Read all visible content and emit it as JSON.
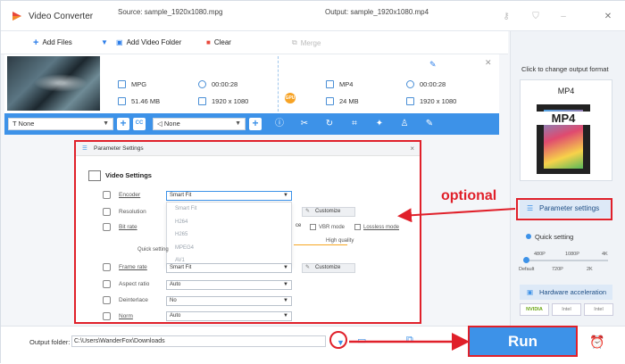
{
  "app": {
    "title": "Video Converter"
  },
  "toolbar": {
    "add_files": "Add Files",
    "add_video_folder": "Add Video Folder",
    "clear": "Clear",
    "merge": "Merge"
  },
  "task": {
    "source": "Source: sample_1920x1080.mpg",
    "output": "Output: sample_1920x1080.mp4",
    "src_format": "MPG",
    "src_duration": "00:00:28",
    "src_size": "51.46 MB",
    "src_resolution": "1920 x 1080",
    "out_format": "MP4",
    "out_duration": "00:00:28",
    "out_size": "24 MB",
    "out_resolution": "1920 x 1080",
    "gpu_badge": "GPU"
  },
  "editbar": {
    "subtitle": "None",
    "audio": "None"
  },
  "right_panel": {
    "click_to_change": "Click to change output format",
    "format": "MP4",
    "format_icon_text": "MP4",
    "parameter_settings": "Parameter settings",
    "quick_setting": "Quick setting",
    "ticks_top": [
      "480P",
      "1080P",
      "4K"
    ],
    "ticks_bottom": [
      "Default",
      "720P",
      "2K"
    ],
    "hardware_acceleration": "Hardware acceleration",
    "chips": [
      "NVIDIA",
      "Intel",
      "Intel"
    ]
  },
  "dialog": {
    "title": "Parameter Settings",
    "video_settings": "Video Settings",
    "encoder_label": "Encoder",
    "encoder_value": "Smart Fit",
    "encoder_options": [
      "Smart Fit",
      "H264",
      "H265",
      "MPEG4",
      "AV1"
    ],
    "resolution_label": "Resolution",
    "bitrate_label": "Bit rate",
    "quick_setting": "Quick setting",
    "high_quality": "High quality",
    "vbr_mode": "VBR mode",
    "lossless_mode": "Lossless mode",
    "customize": "Customize",
    "frame_rate_label": "Frame rate",
    "frame_rate_value": "Smart Fit",
    "aspect_ratio_label": "Aspect ratio",
    "aspect_ratio_value": "Auto",
    "deinterlace_label": "Deinterlace",
    "deinterlace_value": "No",
    "norm_label": "Norm",
    "norm_value": "Auto",
    "close": "×",
    "ce_fragment": "ce"
  },
  "bottom": {
    "output_folder_label": "Output folder:",
    "output_folder_value": "C:\\Users\\WanderFox\\Downloads",
    "run": "Run"
  },
  "annotation": {
    "optional": "optional"
  },
  "colors": {
    "accent": "#3d92e8",
    "annotation": "#e0202a",
    "gpu": "#f7a325"
  }
}
